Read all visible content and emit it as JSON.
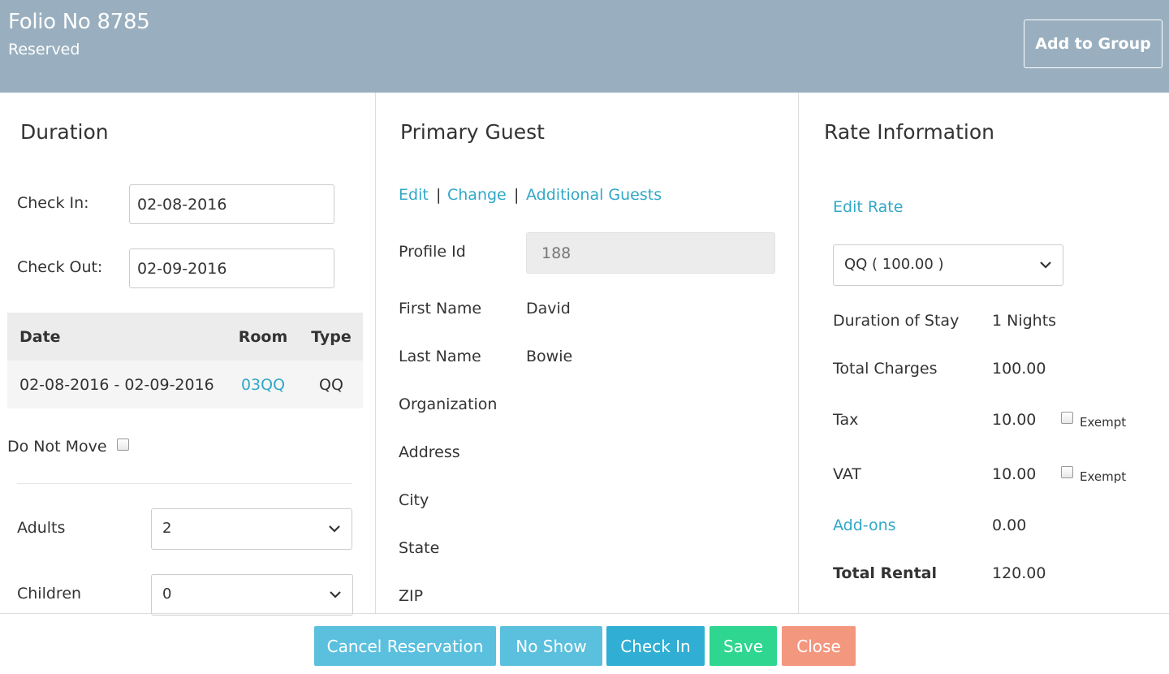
{
  "header": {
    "title": "Folio No 8785",
    "status": "Reserved",
    "add_group_label": "Add to Group"
  },
  "duration": {
    "title": "Duration",
    "check_in_label": "Check In:",
    "check_in_value": "02-08-2016",
    "check_out_label": "Check Out:",
    "check_out_value": "02-09-2016",
    "table": {
      "headers": [
        "Date",
        "Room",
        "Type"
      ],
      "rows": [
        {
          "date": "02-08-2016 - 02-09-2016",
          "room": "03QQ",
          "type": "QQ"
        }
      ]
    },
    "do_not_move_label": "Do Not Move",
    "adults_label": "Adults",
    "adults_value": "2",
    "children_label": "Children",
    "children_value": "0"
  },
  "guest": {
    "title": "Primary Guest",
    "links": [
      "Edit",
      "Change",
      "Additional Guests"
    ],
    "separator": "|",
    "profile_id_label": "Profile Id",
    "profile_id_value": "188",
    "first_name_label": "First Name",
    "first_name_value": "David",
    "last_name_label": "Last Name",
    "last_name_value": "Bowie",
    "organization_label": "Organization",
    "address_label": "Address",
    "city_label": "City",
    "state_label": "State",
    "zip_label": "ZIP"
  },
  "rate": {
    "title": "Rate Information",
    "edit_rate_label": "Edit Rate",
    "rate_select_value": "QQ ( 100.00 )",
    "duration_label": "Duration of Stay",
    "duration_value": "1 Nights",
    "total_charges_label": "Total Charges",
    "total_charges_value": "100.00",
    "tax_label": "Tax",
    "tax_value": "10.00",
    "vat_label": "VAT",
    "vat_value": "10.00",
    "exempt_label": "Exempt",
    "addons_label": "Add-ons",
    "addons_value": "0.00",
    "total_rental_label": "Total Rental",
    "total_rental_value": "120.00"
  },
  "footer": {
    "cancel_label": "Cancel Reservation",
    "noshow_label": "No Show",
    "checkin_label": "Check In",
    "save_label": "Save",
    "close_label": "Close"
  },
  "colors": {
    "header_bg": "#99afbf",
    "link": "#31a8c7",
    "btn_info": "#5bc0de",
    "btn_primary": "#31aed3",
    "btn_save": "#2fd690",
    "btn_close": "#f4977f"
  },
  "icons": {
    "select_arrow": "chevron-down-icon"
  }
}
